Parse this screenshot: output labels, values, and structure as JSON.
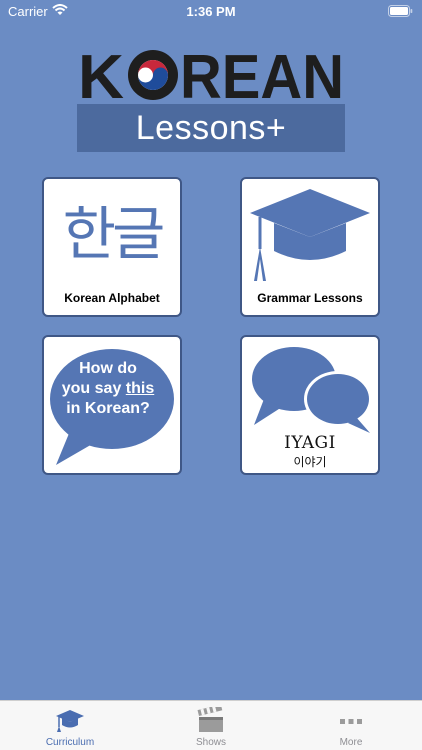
{
  "status_bar": {
    "carrier": "Carrier",
    "time": "1:36 PM"
  },
  "logo": {
    "brand_left": "K",
    "brand_right": "REAN",
    "banner": "Lessons+"
  },
  "tiles": [
    {
      "label": "Korean Alphabet",
      "glyph": "한글",
      "icon": "hangul-icon"
    },
    {
      "label": "Grammar Lessons",
      "icon": "graduation-cap-icon"
    },
    {
      "bubble_line1": "How do",
      "bubble_line2a": "you say ",
      "bubble_line2b": "this",
      "bubble_line3": "in Korean?",
      "icon": "speech-bubble-icon"
    },
    {
      "title": "IYAGI",
      "subtitle": "이야기",
      "icon": "chat-bubbles-icon"
    }
  ],
  "tab_bar": {
    "items": [
      {
        "label": "Curriculum",
        "icon": "graduation-cap-icon",
        "selected": true
      },
      {
        "label": "Shows",
        "icon": "clapperboard-icon",
        "selected": false
      },
      {
        "label": "More",
        "icon": "more-dots-icon",
        "selected": false
      }
    ]
  },
  "colors": {
    "background": "#6b8cc4",
    "banner": "#4c6a9e",
    "accent": "#5576b4",
    "tab_active": "#4a6db0"
  }
}
